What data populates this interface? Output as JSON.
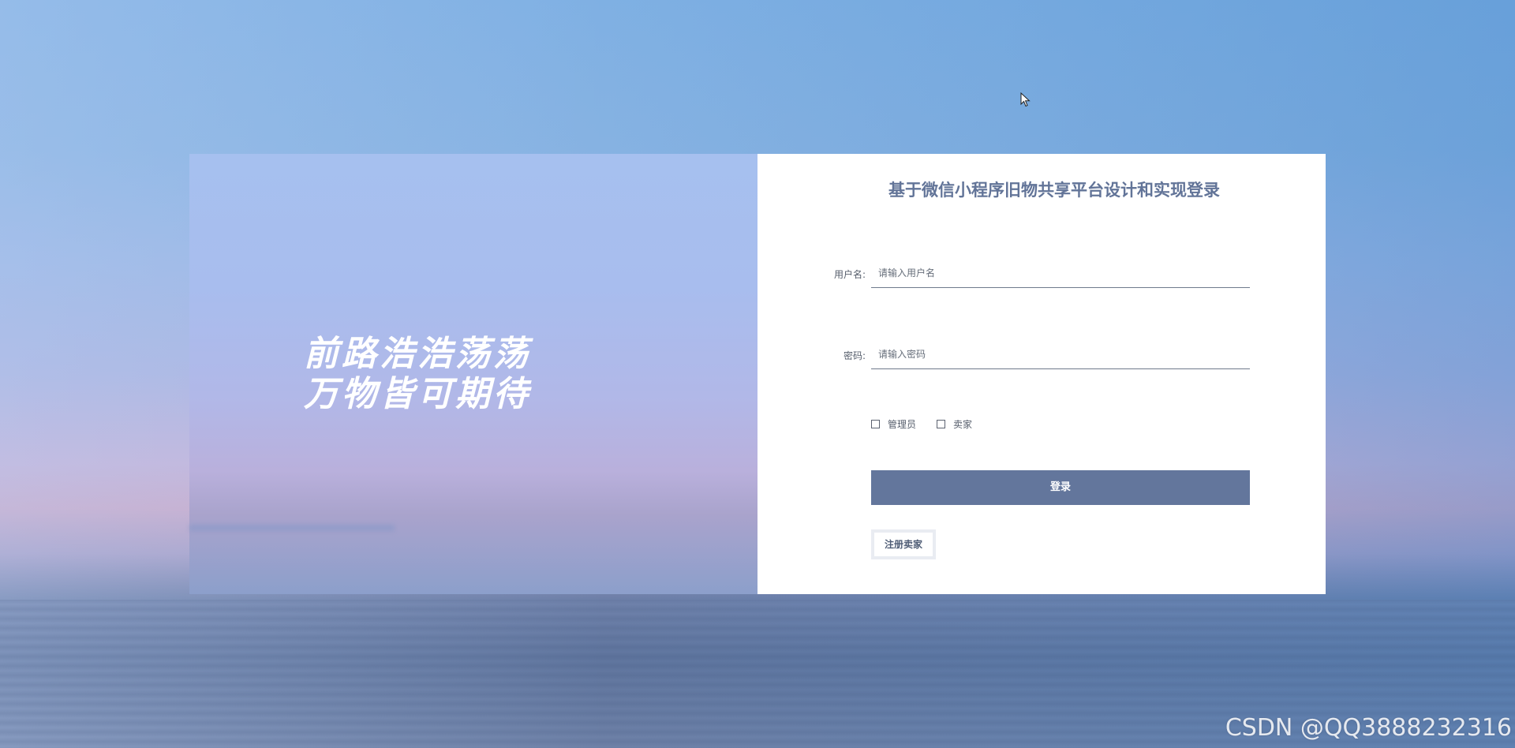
{
  "login_form": {
    "title": "基于微信小程序旧物共享平台设计和实现登录",
    "username": {
      "label": "用户名:",
      "placeholder": "请输入用户名",
      "value": ""
    },
    "password": {
      "label": "密码:",
      "placeholder": "请输入密码",
      "value": ""
    },
    "roles": [
      {
        "label": "管理员",
        "checked": false
      },
      {
        "label": "卖家",
        "checked": false
      }
    ],
    "login_button": "登录",
    "register_button": "注册卖家"
  },
  "hero": {
    "line1": "前路浩浩荡荡",
    "line2": "万物皆可期待"
  },
  "watermark": "CSDN @QQ3888232316",
  "colors": {
    "accent": "#63769c",
    "title": "#627498"
  }
}
